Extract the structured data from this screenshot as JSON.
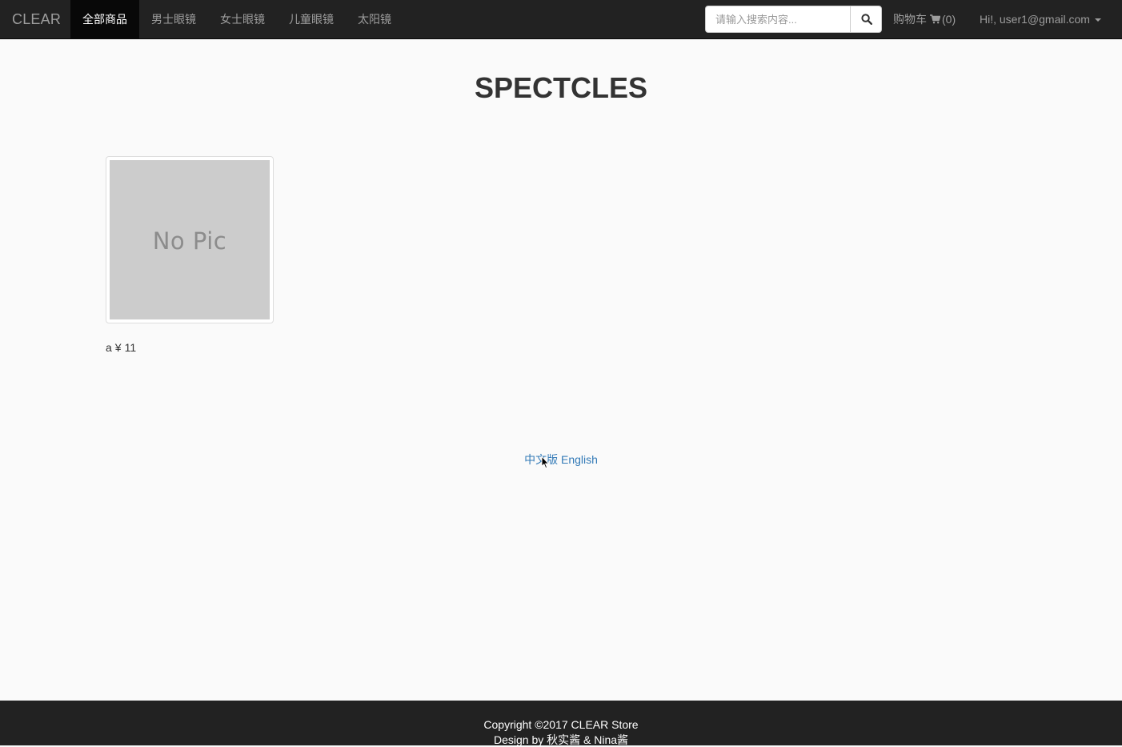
{
  "navbar": {
    "brand": "CLEAR",
    "items": [
      {
        "label": "全部商品",
        "active": true
      },
      {
        "label": "男士眼镜",
        "active": false
      },
      {
        "label": "女士眼镜",
        "active": false
      },
      {
        "label": "儿童眼镜",
        "active": false
      },
      {
        "label": "太阳镜",
        "active": false
      }
    ],
    "search": {
      "placeholder": "请输入搜索内容...",
      "value": "",
      "button_icon": "search-icon"
    },
    "cart": {
      "label": "购物车",
      "icon": "cart-icon",
      "count": "(0)"
    },
    "user": {
      "greeting": "Hi!, user1@gmail.com",
      "icon": "caret-down-icon"
    }
  },
  "main": {
    "title": "SPECTCLES",
    "products": [
      {
        "image_placeholder": "No Pic",
        "name": "a",
        "currency": "¥",
        "price": "11"
      }
    ],
    "language_switch": {
      "chinese": "中文版",
      "english": "English"
    }
  },
  "footer": {
    "copyright": "Copyright ©2017 CLEAR Store",
    "design": "Design by 秋实酱 & Nina酱"
  },
  "colors": {
    "navbar_bg": "#222222",
    "active_nav_bg": "#080808",
    "link": "#337ab7",
    "page_bg": "#fafafa"
  }
}
